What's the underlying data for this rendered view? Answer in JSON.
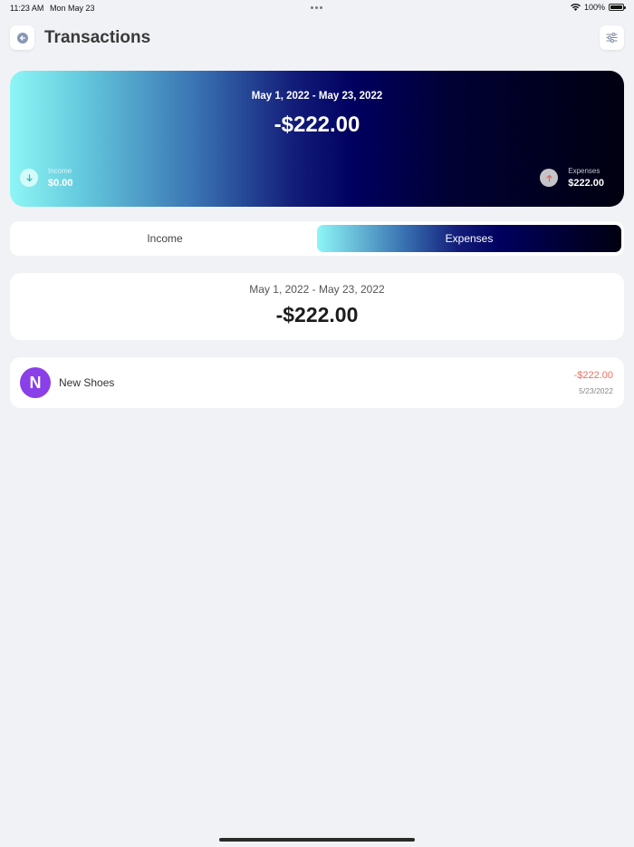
{
  "status_bar": {
    "time": "11:23 AM",
    "date": "Mon May 23",
    "battery": "100%"
  },
  "header": {
    "title": "Transactions",
    "back_icon": "back-arrow-icon",
    "filter_icon": "sliders-icon"
  },
  "summary_card": {
    "date_range": "May 1, 2022 - May 23, 2022",
    "total": "-$222.00",
    "income": {
      "label": "Income",
      "value": "$0.00",
      "icon": "arrow-down-icon"
    },
    "expenses": {
      "label": "Expenses",
      "value": "$222.00",
      "icon": "arrow-up-icon"
    }
  },
  "tabs": [
    {
      "label": "Income",
      "selected": false
    },
    {
      "label": "Expenses",
      "selected": true
    }
  ],
  "period_summary": {
    "date_range": "May 1, 2022 - May 23, 2022",
    "total": "-$222.00"
  },
  "transactions": [
    {
      "initial": "N",
      "name": "New Shoes",
      "amount": "-$222.00",
      "date": "5/23/2022",
      "avatar_color": "#8a3fe8",
      "amount_color": "#ee7060"
    }
  ],
  "colors": {
    "background": "#f1f2f6",
    "gradient_start": "#8ef6f6",
    "gradient_mid": "#00005f",
    "gradient_end": "#000010",
    "negative": "#ee7060"
  }
}
